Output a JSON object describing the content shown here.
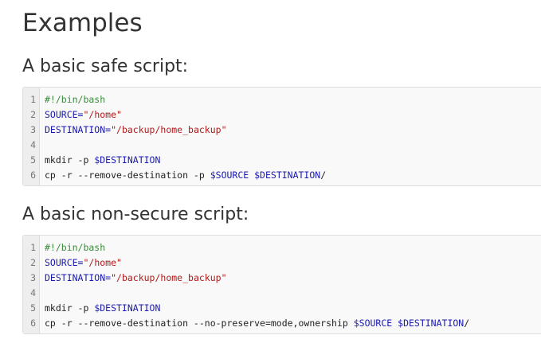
{
  "page_title": "Examples",
  "sections": [
    {
      "title": "A basic safe script:",
      "line_numbers": [
        "1",
        "2",
        "3",
        "4",
        "5",
        "6"
      ],
      "lines": [
        [
          {
            "t": "#!/bin/bash",
            "c": "comment"
          }
        ],
        [
          {
            "t": "SOURCE=",
            "c": "var"
          },
          {
            "t": "\"/home\"",
            "c": "str"
          }
        ],
        [
          {
            "t": "DESTINATION=",
            "c": "var"
          },
          {
            "t": "\"/backup/home_backup\"",
            "c": "str"
          }
        ],
        [],
        [
          {
            "t": "mkdir -p ",
            "c": "plain"
          },
          {
            "t": "$DESTINATION",
            "c": "var"
          }
        ],
        [
          {
            "t": "cp -r --remove-destination -p ",
            "c": "plain"
          },
          {
            "t": "$SOURCE",
            "c": "var"
          },
          {
            "t": " ",
            "c": "plain"
          },
          {
            "t": "$DESTINATION",
            "c": "var"
          },
          {
            "t": "/",
            "c": "plain"
          }
        ]
      ]
    },
    {
      "title": "A basic non-secure script:",
      "line_numbers": [
        "1",
        "2",
        "3",
        "4",
        "5",
        "6"
      ],
      "lines": [
        [
          {
            "t": "#!/bin/bash",
            "c": "comment"
          }
        ],
        [
          {
            "t": "SOURCE=",
            "c": "var"
          },
          {
            "t": "\"/home\"",
            "c": "str"
          }
        ],
        [
          {
            "t": "DESTINATION=",
            "c": "var"
          },
          {
            "t": "\"/backup/home_backup\"",
            "c": "str"
          }
        ],
        [],
        [
          {
            "t": "mkdir -p ",
            "c": "plain"
          },
          {
            "t": "$DESTINATION",
            "c": "var"
          }
        ],
        [
          {
            "t": "cp -r --remove-destination --no-preserve=mode,ownership ",
            "c": "plain"
          },
          {
            "t": "$SOURCE",
            "c": "var"
          },
          {
            "t": " ",
            "c": "plain"
          },
          {
            "t": "$DESTINATION",
            "c": "var"
          },
          {
            "t": "/",
            "c": "plain"
          }
        ]
      ]
    }
  ],
  "colors": {
    "comment": "#3b8a3b",
    "variable": "#1a1ab0",
    "string": "#b01a1a",
    "code_background": "#f9f9f9",
    "gutter_background": "#eeeeee"
  }
}
